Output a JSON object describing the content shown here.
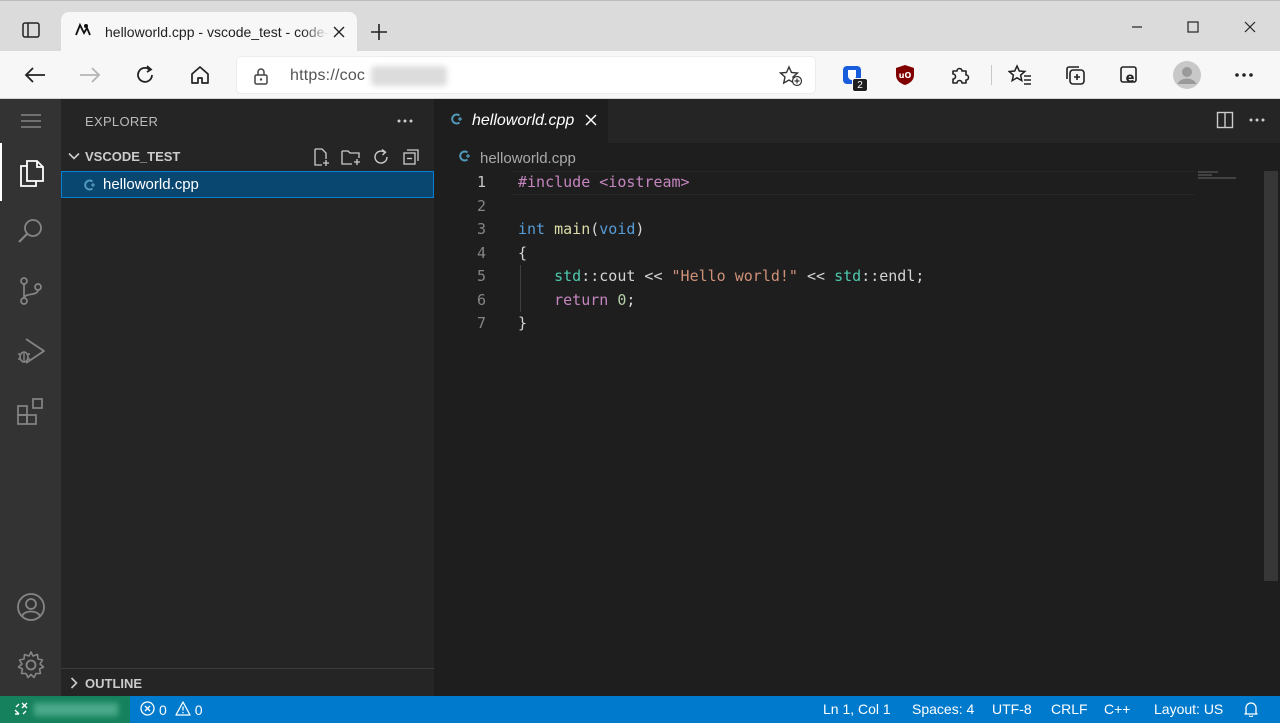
{
  "browser": {
    "tab_title": "helloworld.cpp - vscode_test - code-server",
    "url_prefix": "https://coc",
    "extension_badge": "2"
  },
  "activity_bar": {
    "items": [
      "explorer-icon",
      "search-icon",
      "source-control-icon",
      "run-debug-icon",
      "extensions-icon"
    ],
    "bottom": [
      "account-icon",
      "manage-gear-icon"
    ]
  },
  "sidebar": {
    "title": "EXPLORER",
    "folder_name": "VSCODE_TEST",
    "files": [
      {
        "name": "helloworld.cpp"
      }
    ],
    "outline_label": "OUTLINE"
  },
  "editor": {
    "tab_label": "helloworld.cpp",
    "breadcrumb": "helloworld.cpp",
    "lines": [
      {
        "n": "1",
        "tokens": [
          {
            "t": "#include <iostream>",
            "c": "kw-pre"
          }
        ]
      },
      {
        "n": "2",
        "tokens": []
      },
      {
        "n": "3",
        "tokens": [
          {
            "t": "int",
            "c": "typ"
          },
          {
            "t": " ",
            "c": "plain"
          },
          {
            "t": "main",
            "c": "fn"
          },
          {
            "t": "(",
            "c": "plain"
          },
          {
            "t": "void",
            "c": "typ"
          },
          {
            "t": ")",
            "c": "plain"
          }
        ]
      },
      {
        "n": "4",
        "tokens": [
          {
            "t": "{",
            "c": "plain"
          }
        ]
      },
      {
        "n": "5",
        "tokens": [
          {
            "t": "    ",
            "c": "plain"
          },
          {
            "t": "std",
            "c": "ns"
          },
          {
            "t": "::",
            "c": "plain"
          },
          {
            "t": "cout",
            "c": "plain"
          },
          {
            "t": " << ",
            "c": "plain"
          },
          {
            "t": "\"Hello world!\"",
            "c": "str"
          },
          {
            "t": " << ",
            "c": "plain"
          },
          {
            "t": "std",
            "c": "ns"
          },
          {
            "t": "::",
            "c": "plain"
          },
          {
            "t": "endl",
            "c": "plain"
          },
          {
            "t": ";",
            "c": "plain"
          }
        ]
      },
      {
        "n": "6",
        "tokens": [
          {
            "t": "    ",
            "c": "plain"
          },
          {
            "t": "return",
            "c": "ctl"
          },
          {
            "t": " ",
            "c": "plain"
          },
          {
            "t": "0",
            "c": "num"
          },
          {
            "t": ";",
            "c": "plain"
          }
        ]
      },
      {
        "n": "7",
        "tokens": [
          {
            "t": "}",
            "c": "plain"
          }
        ]
      }
    ]
  },
  "statusbar": {
    "errors": "0",
    "warnings": "0",
    "position": "Ln 1, Col 1",
    "spaces": "Spaces: 4",
    "encoding": "UTF-8",
    "eol": "CRLF",
    "language": "C++",
    "layout": "Layout: US"
  },
  "colors": {
    "statusbar": "#007acc",
    "remote": "#16825d",
    "selection": "#094771",
    "activity_bar": "#333333",
    "sidebar": "#252526",
    "editor": "#1e1e1e"
  }
}
